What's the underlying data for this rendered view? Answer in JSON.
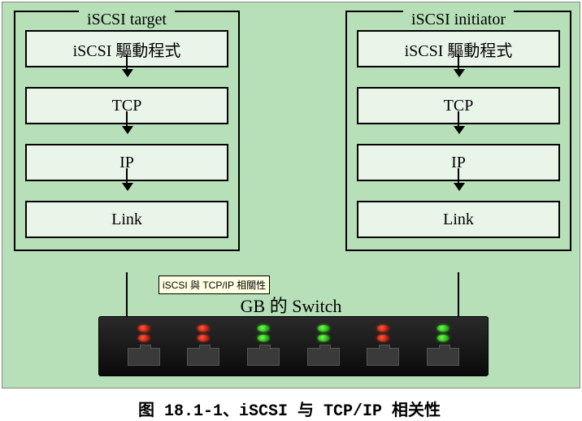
{
  "left_stack": {
    "title": "iSCSI target",
    "layers": [
      "iSCSI 驅動程式",
      "TCP",
      "IP",
      "Link"
    ]
  },
  "right_stack": {
    "title": "iSCSI initiator",
    "layers": [
      "iSCSI 驅動程式",
      "TCP",
      "IP",
      "Link"
    ]
  },
  "tooltip": "iSCSI 與 TCP/IP 相關性",
  "switch_label": "GB 的 Switch",
  "switch_leds": [
    "red",
    "red",
    "green",
    "green",
    "red",
    "green"
  ],
  "caption": "图 18.1-1、iSCSI 与 TCP/IP 相关性"
}
